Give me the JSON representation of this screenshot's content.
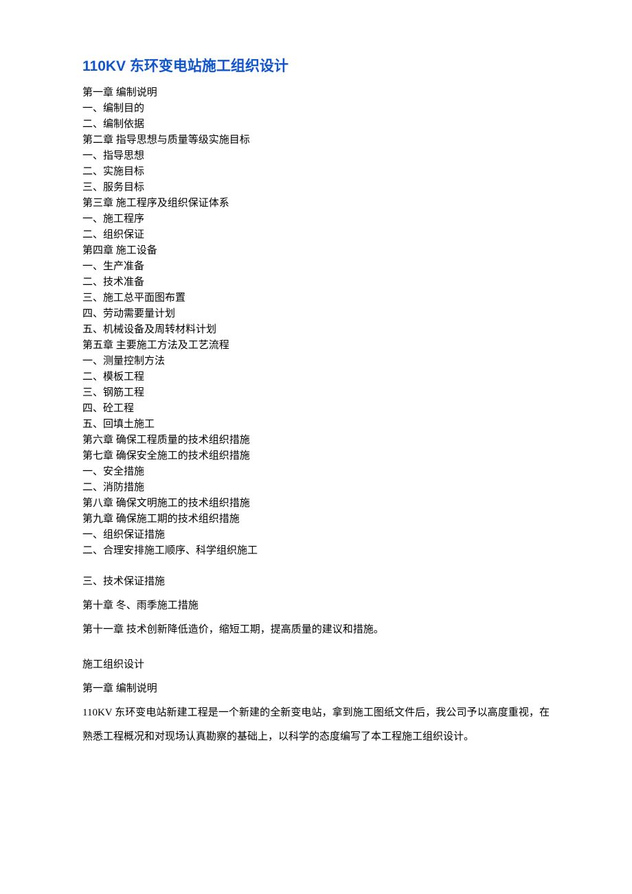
{
  "title": "110KV 东环变电站施工组织设计",
  "toc": [
    "第一章  编制说明",
    "一、编制目的",
    "二、编制依据",
    "第二章  指导思想与质量等级实施目标",
    "一、指导思想",
    "二、实施目标",
    "三、服务目标",
    "第三章  施工程序及组织保证体系",
    "一、施工程序",
    "二、组织保证",
    "第四章  施工设备",
    "一、生产准备",
    "二、技术准备",
    "三、施工总平面图布置",
    "四、劳动需要量计划",
    "五、机械设备及周转材料计划",
    "第五章  主要施工方法及工艺流程",
    "一、测量控制方法",
    "二、模板工程",
    "三、钢筋工程",
    "四、砼工程",
    "五、回填土施工",
    "第六章  确保工程质量的技术组织措施",
    "第七章  确保安全施工的技术组织措施",
    "一、安全措施",
    "二、消防措施",
    "第八章  确保文明施工的技术组织措施",
    "第九章  确保施工期的技术组织措施",
    "一、组织保证措施",
    "二、合理安排施工顺序、科学组织施工"
  ],
  "toc2": [
    "三、技术保证措施",
    "第十章  冬、雨季施工措施",
    "第十一章  技术创新降低造价，缩短工期，提高质量的建议和措施。"
  ],
  "body": {
    "heading1": "施工组织设计",
    "heading2": "第一章  编制说明",
    "paragraph": "110KV 东环变电站新建工程是一个新建的全新变电站，拿到施工图纸文件后，我公司予以高度重视，在熟悉工程概况和对现场认真勘察的基础上，以科学的态度编写了本工程施工组织设计。"
  }
}
